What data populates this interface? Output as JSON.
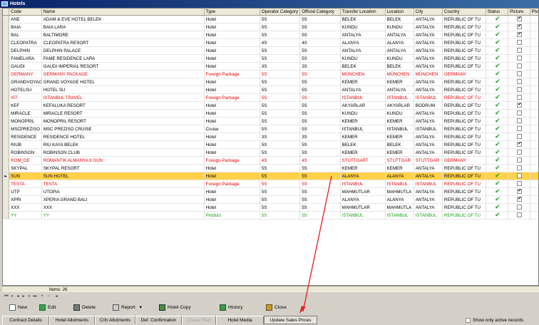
{
  "window": {
    "title": "Hotels"
  },
  "columns": [
    "Code",
    "Name",
    "Type",
    "Operator Category",
    "Official Category",
    "Transfer Location",
    "Location",
    "City",
    "Country",
    "Status",
    "Picture",
    "Phone"
  ],
  "rows": [
    {
      "code": "ANE",
      "name": "ADAM & EVE HOTEL BELEK",
      "type": "Hotel",
      "opcat": "5S",
      "offcat": "5S",
      "transfer": "BELEK",
      "location": "BELEK",
      "city": "ANTALYA",
      "country": "REPUBLIC OF TU",
      "status": true,
      "picture": true,
      "color": "normal"
    },
    {
      "code": "BAIA",
      "name": "BAIA LARA",
      "type": "Hotel",
      "opcat": "5S",
      "offcat": "5S",
      "transfer": "KUNDU",
      "location": "KUNDU",
      "city": "ANTALYA",
      "country": "REPUBLIC OF TU",
      "status": true,
      "picture": true,
      "color": "normal"
    },
    {
      "code": "BAL",
      "name": "BALTIMORE",
      "type": "Hotel",
      "opcat": "5S",
      "offcat": "5S",
      "transfer": "ANTALYA",
      "location": "ANTALYA",
      "city": "ANTALYA",
      "country": "REPUBLIC OF TU",
      "status": true,
      "picture": true,
      "color": "normal"
    },
    {
      "code": "CLEOPATRA",
      "name": "CLEOPATRA RESORT",
      "type": "Hotel",
      "opcat": "4S",
      "offcat": "4S",
      "transfer": "ALANYA",
      "location": "ALANYA",
      "city": "ANTALYA",
      "country": "REPUBLIC OF TU",
      "status": true,
      "picture": false,
      "color": "normal"
    },
    {
      "code": "DELPHIN",
      "name": "DELPHIN PALACE",
      "type": "Hotel",
      "opcat": "5S",
      "offcat": "5S",
      "transfer": "ANTALYA",
      "location": "ANTALYA",
      "city": "ANTALYA",
      "country": "REPUBLIC OF TU",
      "status": true,
      "picture": false,
      "color": "normal"
    },
    {
      "code": "FAMELARA",
      "name": "FAME RESIDENCE LARA",
      "type": "Hotel",
      "opcat": "5S",
      "offcat": "5S",
      "transfer": "KUNDU",
      "location": "KUNDU",
      "city": "ANTALYA",
      "country": "REPUBLIC OF TU",
      "status": true,
      "picture": false,
      "color": "normal"
    },
    {
      "code": "GAUDI",
      "name": "GAUDI IMPERIAL RESORT",
      "type": "Hotel",
      "opcat": "3S",
      "offcat": "3S",
      "transfer": "BELEK",
      "location": "BELEK",
      "city": "ANTALYA",
      "country": "REPUBLIC OF TU",
      "status": true,
      "picture": false,
      "color": "normal"
    },
    {
      "code": "GERMANY",
      "name": "GERMANY PACKAGE",
      "type": "Foreign Package",
      "opcat": "5S",
      "offcat": "5S",
      "transfer": "MÜNCHEN",
      "location": "MÜNCHEN",
      "city": "MÜNCHEN",
      "country": "GERMANY",
      "status": true,
      "picture": false,
      "color": "red"
    },
    {
      "code": "GRANDVOYAG",
      "name": "GRAND VOYAGE HOTEL",
      "type": "Hotel",
      "opcat": "5S",
      "offcat": "5S",
      "transfer": "KEMER",
      "location": "KEMER",
      "city": "ANTALYA",
      "country": "REPUBLIC OF TU",
      "status": true,
      "picture": false,
      "color": "normal"
    },
    {
      "code": "HOTELSU",
      "name": "HOTEL SU",
      "type": "Hotel",
      "opcat": "5S",
      "offcat": "5S",
      "transfer": "ANTALYA",
      "location": "ANTALYA",
      "city": "ANTALYA",
      "country": "REPUBLIC OF TU",
      "status": true,
      "picture": false,
      "color": "normal"
    },
    {
      "code": "IST",
      "name": "ISTANBUL TRAVEL",
      "type": "Foreign Package",
      "opcat": "5S",
      "offcat": "5S",
      "transfer": "ISTANBUL",
      "location": "ISTANBUL",
      "city": "ISTANBUL",
      "country": "REPUBLIC OF TU",
      "status": true,
      "picture": false,
      "color": "red"
    },
    {
      "code": "KEF",
      "name": "KEFALUKA RESORT",
      "type": "Hotel",
      "opcat": "5S",
      "offcat": "5S",
      "transfer": "AKYARLAR",
      "location": "AKYARLAR",
      "city": "BODRUM",
      "country": "REPUBLIC OF TU",
      "status": true,
      "picture": true,
      "color": "normal"
    },
    {
      "code": "MIRACLE",
      "name": "MIRACLE RESORT",
      "type": "Hotel",
      "opcat": "5S",
      "offcat": "5S",
      "transfer": "KUNDU",
      "location": "KUNDU",
      "city": "ANTALYA",
      "country": "REPUBLIC OF TU",
      "status": true,
      "picture": false,
      "color": "normal"
    },
    {
      "code": "MONOPRIL",
      "name": "MONOPRIL RESORT",
      "type": "Hotel",
      "opcat": "5S",
      "offcat": "5S",
      "transfer": "KEMER",
      "location": "KEMER",
      "city": "ANTALYA",
      "country": "REPUBLIC OF TU",
      "status": true,
      "picture": false,
      "color": "normal"
    },
    {
      "code": "MSCPREZISO",
      "name": "MSC PREZISO CRUISE",
      "type": "Cruise",
      "opcat": "5S",
      "offcat": "5S",
      "transfer": "ISTANBUL",
      "location": "ISTANBUL",
      "city": "ISTANBUL",
      "country": "REPUBLIC OF TU",
      "status": true,
      "picture": false,
      "color": "normal"
    },
    {
      "code": "RESIDENCE",
      "name": "RESIDENCE HOTEL",
      "type": "Hotel",
      "opcat": "3S",
      "offcat": "3S",
      "transfer": "KEMER",
      "location": "KEMER",
      "city": "ANTALYA",
      "country": "REPUBLIC OF TU",
      "status": true,
      "picture": false,
      "color": "normal"
    },
    {
      "code": "RIUB",
      "name": "RIU KAYA BELEK",
      "type": "Hotel",
      "opcat": "5S",
      "offcat": "5S",
      "transfer": "BELEK",
      "location": "BELEK",
      "city": "ANTALYA",
      "country": "REPUBLIC OF TU",
      "status": true,
      "picture": true,
      "color": "normal"
    },
    {
      "code": "ROBINSON",
      "name": "ROBINSON CLUB",
      "type": "Hotel",
      "opcat": "5S",
      "offcat": "5S",
      "transfer": "KEMER",
      "location": "KEMER",
      "city": "ANTALYA",
      "country": "REPUBLIC OF TU",
      "status": true,
      "picture": false,
      "color": "normal"
    },
    {
      "code": "ROM_DE",
      "name": "ROMANTIK ALMANYA 8 GUN",
      "type": "Foreign Package",
      "opcat": "4S",
      "offcat": "4S",
      "transfer": "STUTTGART",
      "location": "STUTTGAR",
      "city": "STUTTGAR",
      "country": "GERMANY",
      "status": true,
      "picture": false,
      "color": "red"
    },
    {
      "code": "SKYPAL",
      "name": "SKYPAL RESORT",
      "type": "Hotel",
      "opcat": "5S",
      "offcat": "5S",
      "transfer": "KEMER",
      "location": "KEMER",
      "city": "ANTALYA",
      "country": "REPUBLIC OF TU",
      "status": true,
      "picture": false,
      "color": "normal"
    },
    {
      "code": "SUN",
      "name": "SUN HOTEL",
      "type": "Hotel",
      "opcat": "5S",
      "offcat": "5S",
      "transfer": "ALANYA",
      "location": "ALANYA",
      "city": "ANTALYA",
      "country": "REPUBLIC OF TU",
      "status": true,
      "picture": false,
      "color": "sel"
    },
    {
      "code": "TESTA",
      "name": "TESTA",
      "type": "Foreign Package",
      "opcat": "5S",
      "offcat": "5S",
      "transfer": "ISTANBUL",
      "location": "ISTANBUL",
      "city": "ISTANBUL",
      "country": "REPUBLIC OF TU",
      "status": true,
      "picture": false,
      "color": "red"
    },
    {
      "code": "UTP",
      "name": "UTOPIA",
      "type": "Hotel",
      "opcat": "5S",
      "offcat": "5S",
      "transfer": "MAHMUTLAR",
      "location": "MAHMUTLA",
      "city": "ANTALYA",
      "country": "REPUBLIC OF TU",
      "status": true,
      "picture": true,
      "color": "normal"
    },
    {
      "code": "XPRI",
      "name": "XPERIA GRAND BALI",
      "type": "Hotel",
      "opcat": "5S",
      "offcat": "5S",
      "transfer": "ALANYA",
      "location": "ALANYA",
      "city": "ANTALYA",
      "country": "REPUBLIC OF TU",
      "status": true,
      "picture": true,
      "color": "normal"
    },
    {
      "code": "XXX",
      "name": "XXX",
      "type": "Hotel",
      "opcat": "5S",
      "offcat": "5S",
      "transfer": "MAHMUTLAR",
      "location": "MAHMUTLA",
      "city": "ANTALYA",
      "country": "REPUBLIC OF TU",
      "status": true,
      "picture": false,
      "color": "normal"
    },
    {
      "code": "YY",
      "name": "YY",
      "type": "Product",
      "opcat": "5S",
      "offcat": "5S",
      "transfer": "ISTANBUL",
      "location": "ISTANBUL",
      "city": "ISTANBUL",
      "country": "REPUBLIC OF TU",
      "status": true,
      "picture": false,
      "color": "green"
    }
  ],
  "footer": {
    "items_label": "Items: 26"
  },
  "toolbar": {
    "new": "New",
    "edit": "Edit",
    "delete": "Delete",
    "report": "Report",
    "hotel_copy": "Hotel Copy",
    "history": "History",
    "close": "Close"
  },
  "tabs": [
    "Contract Details",
    "Hotel Allotments",
    "C/In Allotments",
    "Def. Confirmation",
    "Cruise Plan",
    "Hotel Media",
    "Update Sales Prices"
  ],
  "show_active_label": "Show only active records",
  "colors": {
    "red_text": "#e60000",
    "green_text": "#16a30e",
    "selected_row": "#ffd24a",
    "status_check": "#1fa01f",
    "annotation_arrow": "#e02020"
  }
}
